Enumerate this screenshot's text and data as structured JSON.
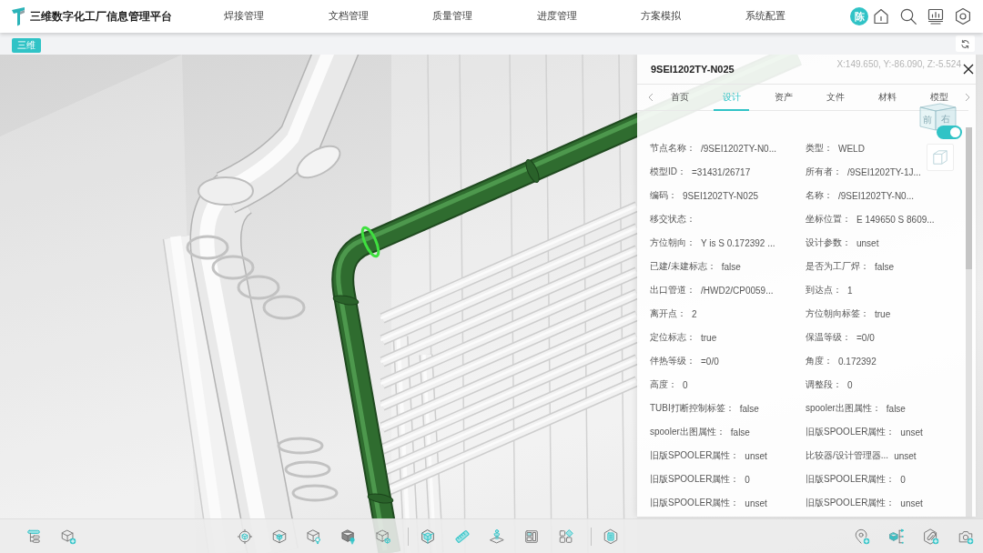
{
  "app": {
    "title": "三维数字化工厂信息管理平台"
  },
  "nav": [
    "焊接管理",
    "文档管理",
    "质量管理",
    "进度管理",
    "方案模拟",
    "系统配置"
  ],
  "user": {
    "avatar": "陈"
  },
  "view_tabs": [
    {
      "label": "三维",
      "selected": true
    }
  ],
  "viewport": {
    "coordinates": "X:149.650, Y:-86.090, Z:-5.524",
    "view_cube": {
      "front": "前",
      "right": "右"
    },
    "toggle": {
      "on": true
    }
  },
  "panel": {
    "title": "9SEI1202TY-N025",
    "tabs": [
      {
        "label": "首页",
        "selected": false
      },
      {
        "label": "设计",
        "selected": true
      },
      {
        "label": "资产",
        "selected": false
      },
      {
        "label": "文件",
        "selected": false
      },
      {
        "label": "材料",
        "selected": false
      },
      {
        "label": "模型",
        "selected": false
      }
    ],
    "properties": [
      {
        "label": "节点名称：",
        "value": "/9SEI1202TY-N0..."
      },
      {
        "label": "类型：",
        "value": "WELD"
      },
      {
        "label": "模型ID：",
        "value": "=31431/26717"
      },
      {
        "label": "所有者：",
        "value": "/9SEI1202TY-1J..."
      },
      {
        "label": "编码：",
        "value": "9SEI1202TY-N025"
      },
      {
        "label": "名称：",
        "value": "/9SEI1202TY-N0..."
      },
      {
        "label": "移交状态："
      },
      {
        "label": "坐标位置：",
        "value": "E 149650 S 8609..."
      },
      {
        "label": "方位朝向：",
        "value": "Y is S 0.172392 ..."
      },
      {
        "label": "设计参数：",
        "value": "unset"
      },
      {
        "label": "已建/未建标志：",
        "value": "false"
      },
      {
        "label": "是否为工厂焊：",
        "value": "false"
      },
      {
        "label": "出口管道：",
        "value": "/HWD2/CP0059..."
      },
      {
        "label": "到达点：",
        "value": "1"
      },
      {
        "label": "离开点：",
        "value": "2"
      },
      {
        "label": "方位朝向标签：",
        "value": "true"
      },
      {
        "label": "定位标志：",
        "value": "true"
      },
      {
        "label": "保温等级：",
        "value": "=0/0"
      },
      {
        "label": "伴热等级：",
        "value": "=0/0"
      },
      {
        "label": "角度：",
        "value": "0.172392"
      },
      {
        "label": "高度：",
        "value": "0"
      },
      {
        "label": "调整段：",
        "value": "0"
      },
      {
        "label": "TUBI打断控制标签：",
        "value": "false"
      },
      {
        "label": "spooler出图属性：",
        "value": "false"
      },
      {
        "label": "spooler出图属性：",
        "value": "false"
      },
      {
        "label": "旧版SPOOLER属性：",
        "value": "unset"
      },
      {
        "label": "旧版SPOOLER属性：",
        "value": "unset"
      },
      {
        "label": "比较器/设计管理器...",
        "value": "unset"
      },
      {
        "label": "旧版SPOOLER属性：",
        "value": "0"
      },
      {
        "label": "旧版SPOOLER属性：",
        "value": "0"
      },
      {
        "label": "旧版SPOOLER属性：",
        "value": "unset"
      },
      {
        "label": "旧版SPOOLER属性：",
        "value": "unset"
      }
    ]
  }
}
